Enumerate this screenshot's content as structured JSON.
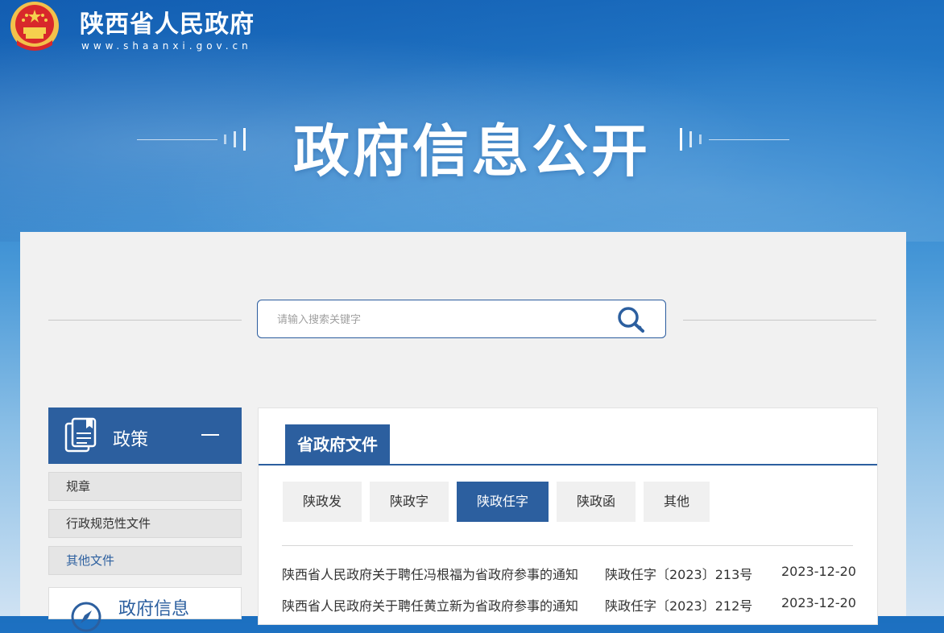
{
  "header": {
    "site_title": "陕西省人民政府",
    "site_url": "www.shaanxi.gov.cn",
    "hero_title": "政府信息公开"
  },
  "search": {
    "placeholder": "请输入搜索关键字",
    "icon": "search-icon"
  },
  "sidebar": {
    "header_label": "政策",
    "header_icon": "document-icon",
    "items": [
      {
        "label": "规章"
      },
      {
        "label": "行政规范性文件"
      },
      {
        "label": "其他文件"
      }
    ],
    "section2_label": "政府信息",
    "section2_icon": "compass-icon"
  },
  "content": {
    "panel_tab": "省政府文件",
    "subtabs": [
      {
        "label": "陕政发"
      },
      {
        "label": "陕政字"
      },
      {
        "label": "陕政任字",
        "active": true
      },
      {
        "label": "陕政函"
      },
      {
        "label": "其他"
      }
    ],
    "rows": [
      {
        "title": "陕西省人民政府关于聘任冯根福为省政府参事的通知",
        "doc_no": "陕政任字〔2023〕213号",
        "date": "2023-12-20"
      },
      {
        "title": "陕西省人民政府关于聘任黄立新为省政府参事的通知",
        "doc_no": "陕政任字〔2023〕212号",
        "date": "2023-12-20"
      }
    ]
  },
  "colors": {
    "brand_blue": "#2c5f9f",
    "banner_blue": "#1c6fc0",
    "panel_bg": "#f1f1f1"
  }
}
